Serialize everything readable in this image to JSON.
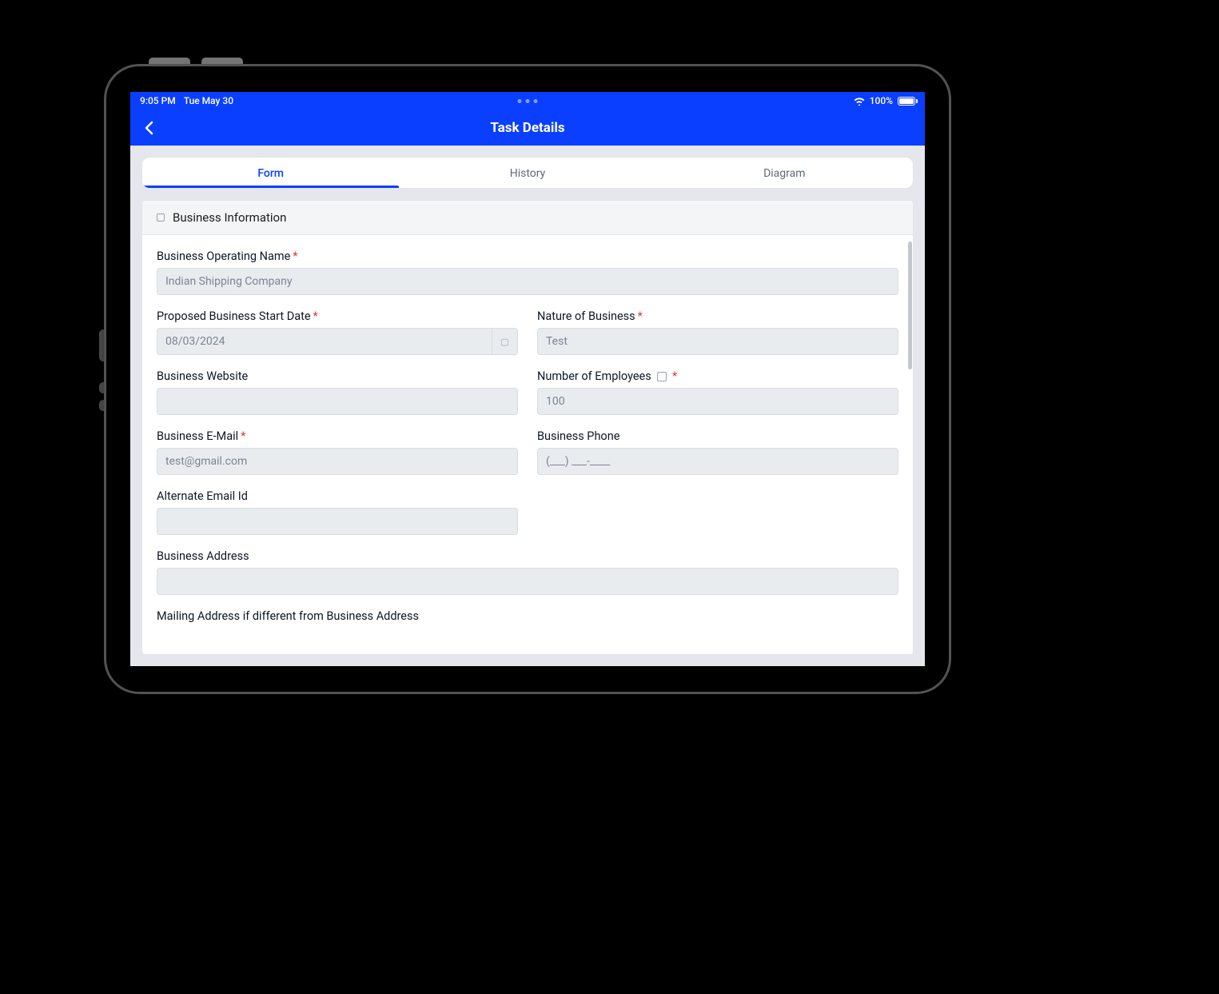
{
  "status": {
    "time": "9:05 PM",
    "date": "Tue May 30",
    "battery_pct": "100%"
  },
  "nav": {
    "title": "Task Details"
  },
  "tabs": [
    {
      "label": "Form"
    },
    {
      "label": "History"
    },
    {
      "label": "Diagram"
    }
  ],
  "section": {
    "title": "Business Information"
  },
  "fields": {
    "operating_name": {
      "label": "Business Operating Name",
      "value": "Indian Shipping Company"
    },
    "start_date": {
      "label": "Proposed Business Start Date",
      "value": "08/03/2024"
    },
    "nature": {
      "label": "Nature of Business",
      "value": "Test"
    },
    "website": {
      "label": "Business Website",
      "value": ""
    },
    "employees": {
      "label": "Number of Employees",
      "value": "100"
    },
    "email": {
      "label": "Business E-Mail",
      "value": "test@gmail.com"
    },
    "phone": {
      "label": "Business Phone",
      "placeholder": "(___) ___-____"
    },
    "alt_email": {
      "label": "Alternate Email Id",
      "value": ""
    },
    "address": {
      "label": "Business Address",
      "value": ""
    },
    "mailing": {
      "label": "Mailing Address if different from Business Address"
    }
  }
}
